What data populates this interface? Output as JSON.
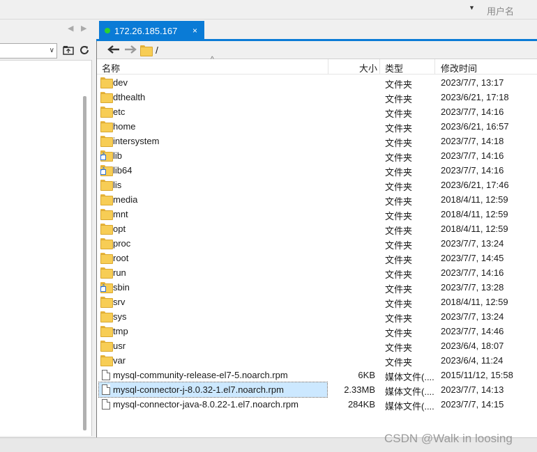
{
  "top": {
    "user_label": "用户名"
  },
  "tab": {
    "title": "172.26.185.167",
    "close": "×",
    "status_color": "#2fd12f"
  },
  "toolbar": {
    "path": "/"
  },
  "columns": {
    "name": "名称",
    "size": "大小",
    "type": "类型",
    "mtime": "修改时间"
  },
  "files": [
    {
      "name": "dev",
      "size": "",
      "type": "文件夹",
      "mtime": "2023/7/7, 13:17",
      "icon": "folder-icon"
    },
    {
      "name": "dthealth",
      "size": "",
      "type": "文件夹",
      "mtime": "2023/6/21, 17:18",
      "icon": "folder-icon"
    },
    {
      "name": "etc",
      "size": "",
      "type": "文件夹",
      "mtime": "2023/7/7, 14:16",
      "icon": "folder-icon"
    },
    {
      "name": "home",
      "size": "",
      "type": "文件夹",
      "mtime": "2023/6/21, 16:57",
      "icon": "folder-icon"
    },
    {
      "name": "intersystem",
      "size": "",
      "type": "文件夹",
      "mtime": "2023/7/7, 14:18",
      "icon": "folder-icon"
    },
    {
      "name": "lib",
      "size": "",
      "type": "文件夹",
      "mtime": "2023/7/7, 14:16",
      "icon": "folder-link-icon"
    },
    {
      "name": "lib64",
      "size": "",
      "type": "文件夹",
      "mtime": "2023/7/7, 14:16",
      "icon": "folder-link-icon"
    },
    {
      "name": "lis",
      "size": "",
      "type": "文件夹",
      "mtime": "2023/6/21, 17:46",
      "icon": "folder-icon"
    },
    {
      "name": "media",
      "size": "",
      "type": "文件夹",
      "mtime": "2018/4/11, 12:59",
      "icon": "folder-icon"
    },
    {
      "name": "mnt",
      "size": "",
      "type": "文件夹",
      "mtime": "2018/4/11, 12:59",
      "icon": "folder-icon"
    },
    {
      "name": "opt",
      "size": "",
      "type": "文件夹",
      "mtime": "2018/4/11, 12:59",
      "icon": "folder-icon"
    },
    {
      "name": "proc",
      "size": "",
      "type": "文件夹",
      "mtime": "2023/7/7, 13:24",
      "icon": "folder-icon"
    },
    {
      "name": "root",
      "size": "",
      "type": "文件夹",
      "mtime": "2023/7/7, 14:45",
      "icon": "folder-icon"
    },
    {
      "name": "run",
      "size": "",
      "type": "文件夹",
      "mtime": "2023/7/7, 14:16",
      "icon": "folder-icon"
    },
    {
      "name": "sbin",
      "size": "",
      "type": "文件夹",
      "mtime": "2023/7/7, 13:28",
      "icon": "folder-link-icon"
    },
    {
      "name": "srv",
      "size": "",
      "type": "文件夹",
      "mtime": "2018/4/11, 12:59",
      "icon": "folder-icon"
    },
    {
      "name": "sys",
      "size": "",
      "type": "文件夹",
      "mtime": "2023/7/7, 13:24",
      "icon": "folder-icon"
    },
    {
      "name": "tmp",
      "size": "",
      "type": "文件夹",
      "mtime": "2023/7/7, 14:46",
      "icon": "folder-icon"
    },
    {
      "name": "usr",
      "size": "",
      "type": "文件夹",
      "mtime": "2023/6/4, 18:07",
      "icon": "folder-icon"
    },
    {
      "name": "var",
      "size": "",
      "type": "文件夹",
      "mtime": "2023/6/4, 11:24",
      "icon": "folder-icon"
    },
    {
      "name": "mysql-community-release-el7-5.noarch.rpm",
      "size": "6KB",
      "type": "媒体文件(....",
      "mtime": "2015/11/12, 15:58",
      "icon": "file-icon"
    },
    {
      "name": "mysql-connector-j-8.0.32-1.el7.noarch.rpm",
      "size": "2.33MB",
      "type": "媒体文件(....",
      "mtime": "2023/7/7, 14:13",
      "icon": "file-icon",
      "selected": true
    },
    {
      "name": "mysql-connector-java-8.0.22-1.el7.noarch.rpm",
      "size": "284KB",
      "type": "媒体文件(....",
      "mtime": "2023/7/7, 14:15",
      "icon": "file-icon"
    }
  ],
  "watermark": "CSDN @Walk in loosing",
  "colors": {
    "accent": "#0a7bd6",
    "selection": "#cce8ff",
    "folder": "#f7cd55"
  }
}
